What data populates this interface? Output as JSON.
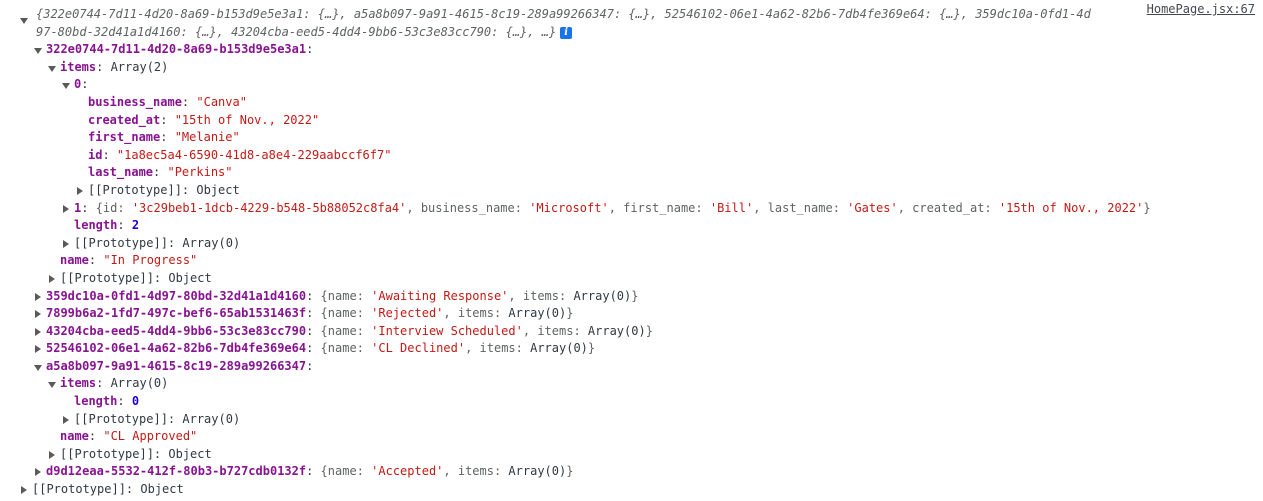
{
  "console": {
    "source_link": "HomePage.jsx:67",
    "info_badge": "i",
    "preview_line": "{322e0744-7d11-4d20-8a69-b153d9e5e3a1: {…}, a5a8b097-9a91-4615-8c19-289a99266347: {…}, 52546102-06e1-4a62-82b6-7db4fe369e64: {…}, 359dc10a-0fd1-4d97-80bd-32d41a1d4160: {…}, 43204cba-eed5-4dd4-9bb6-53c3e83cc790: {…}, …}"
  },
  "rows": [
    {
      "indent": 1,
      "arrow": "open",
      "parts": [
        {
          "t": "322e0744-7d11-4d20-8a69-b153d9e5e3a1",
          "c": "k-obj"
        },
        {
          "t": ":",
          "c": "punc"
        }
      ]
    },
    {
      "indent": 2,
      "arrow": "open",
      "parts": [
        {
          "t": "items",
          "c": "k-obj"
        },
        {
          "t": ": ",
          "c": "punc"
        },
        {
          "t": "Array(2)",
          "c": "v-obj"
        }
      ]
    },
    {
      "indent": 3,
      "arrow": "open",
      "parts": [
        {
          "t": "0",
          "c": "k-obj"
        },
        {
          "t": ":",
          "c": "punc"
        }
      ]
    },
    {
      "indent": 4,
      "arrow": "none",
      "parts": [
        {
          "t": "business_name",
          "c": "k-obj"
        },
        {
          "t": ": ",
          "c": "punc"
        },
        {
          "t": "\"Canva\"",
          "c": "v-str"
        }
      ]
    },
    {
      "indent": 4,
      "arrow": "none",
      "parts": [
        {
          "t": "created_at",
          "c": "k-obj"
        },
        {
          "t": ": ",
          "c": "punc"
        },
        {
          "t": "\"15th of Nov., 2022\"",
          "c": "v-str"
        }
      ]
    },
    {
      "indent": 4,
      "arrow": "none",
      "parts": [
        {
          "t": "first_name",
          "c": "k-obj"
        },
        {
          "t": ": ",
          "c": "punc"
        },
        {
          "t": "\"Melanie\"",
          "c": "v-str"
        }
      ]
    },
    {
      "indent": 4,
      "arrow": "none",
      "parts": [
        {
          "t": "id",
          "c": "k-obj"
        },
        {
          "t": ": ",
          "c": "punc"
        },
        {
          "t": "\"1a8ec5a4-6590-41d8-a8e4-229aabccf6f7\"",
          "c": "v-str"
        }
      ]
    },
    {
      "indent": 4,
      "arrow": "none",
      "parts": [
        {
          "t": "last_name",
          "c": "k-obj"
        },
        {
          "t": ": ",
          "c": "punc"
        },
        {
          "t": "\"Perkins\"",
          "c": "v-str"
        }
      ]
    },
    {
      "indent": 4,
      "arrow": "closed",
      "parts": [
        {
          "t": "[[Prototype]]",
          "c": "proto"
        },
        {
          "t": ": ",
          "c": "punc"
        },
        {
          "t": "Object",
          "c": "v-obj"
        }
      ]
    },
    {
      "indent": 3,
      "arrow": "closed",
      "parts": [
        {
          "t": "1",
          "c": "k-obj"
        },
        {
          "t": ": ",
          "c": "punc"
        },
        {
          "t": "{",
          "c": "k-gray"
        },
        {
          "t": "id",
          "c": "k-gray"
        },
        {
          "t": ": ",
          "c": "k-gray"
        },
        {
          "t": "'3c29beb1-1dcb-4229-b548-5b88052c8fa4'",
          "c": "v-str"
        },
        {
          "t": ", ",
          "c": "k-gray"
        },
        {
          "t": "business_name",
          "c": "k-gray"
        },
        {
          "t": ": ",
          "c": "k-gray"
        },
        {
          "t": "'Microsoft'",
          "c": "v-str"
        },
        {
          "t": ", ",
          "c": "k-gray"
        },
        {
          "t": "first_name",
          "c": "k-gray"
        },
        {
          "t": ": ",
          "c": "k-gray"
        },
        {
          "t": "'Bill'",
          "c": "v-str"
        },
        {
          "t": ", ",
          "c": "k-gray"
        },
        {
          "t": "last_name",
          "c": "k-gray"
        },
        {
          "t": ": ",
          "c": "k-gray"
        },
        {
          "t": "'Gates'",
          "c": "v-str"
        },
        {
          "t": ", ",
          "c": "k-gray"
        },
        {
          "t": "created_at",
          "c": "k-gray"
        },
        {
          "t": ": ",
          "c": "k-gray"
        },
        {
          "t": "'15th of Nov., 2022'",
          "c": "v-str"
        },
        {
          "t": "}",
          "c": "k-gray"
        }
      ]
    },
    {
      "indent": 3,
      "arrow": "none",
      "parts": [
        {
          "t": "length",
          "c": "k-obj"
        },
        {
          "t": ": ",
          "c": "punc"
        },
        {
          "t": "2",
          "c": "v-num"
        }
      ]
    },
    {
      "indent": 3,
      "arrow": "closed",
      "parts": [
        {
          "t": "[[Prototype]]",
          "c": "proto"
        },
        {
          "t": ": ",
          "c": "punc"
        },
        {
          "t": "Array(0)",
          "c": "v-obj"
        }
      ]
    },
    {
      "indent": 2,
      "arrow": "none",
      "parts": [
        {
          "t": "name",
          "c": "k-obj"
        },
        {
          "t": ": ",
          "c": "punc"
        },
        {
          "t": "\"In Progress\"",
          "c": "v-str"
        }
      ]
    },
    {
      "indent": 2,
      "arrow": "closed",
      "parts": [
        {
          "t": "[[Prototype]]",
          "c": "proto"
        },
        {
          "t": ": ",
          "c": "punc"
        },
        {
          "t": "Object",
          "c": "v-obj"
        }
      ]
    },
    {
      "indent": 1,
      "arrow": "closed",
      "parts": [
        {
          "t": "359dc10a-0fd1-4d97-80bd-32d41a1d4160",
          "c": "k-obj"
        },
        {
          "t": ": ",
          "c": "punc"
        },
        {
          "t": "{",
          "c": "k-gray"
        },
        {
          "t": "name",
          "c": "k-gray"
        },
        {
          "t": ": ",
          "c": "k-gray"
        },
        {
          "t": "'Awaiting Response'",
          "c": "v-str"
        },
        {
          "t": ", ",
          "c": "k-gray"
        },
        {
          "t": "items",
          "c": "k-gray"
        },
        {
          "t": ": ",
          "c": "k-gray"
        },
        {
          "t": "Array(0)",
          "c": "v-obj"
        },
        {
          "t": "}",
          "c": "k-gray"
        }
      ]
    },
    {
      "indent": 1,
      "arrow": "closed",
      "parts": [
        {
          "t": "7899b6a2-1fd7-497c-bef6-65ab1531463f",
          "c": "k-obj"
        },
        {
          "t": ": ",
          "c": "punc"
        },
        {
          "t": "{",
          "c": "k-gray"
        },
        {
          "t": "name",
          "c": "k-gray"
        },
        {
          "t": ": ",
          "c": "k-gray"
        },
        {
          "t": "'Rejected'",
          "c": "v-str"
        },
        {
          "t": ", ",
          "c": "k-gray"
        },
        {
          "t": "items",
          "c": "k-gray"
        },
        {
          "t": ": ",
          "c": "k-gray"
        },
        {
          "t": "Array(0)",
          "c": "v-obj"
        },
        {
          "t": "}",
          "c": "k-gray"
        }
      ]
    },
    {
      "indent": 1,
      "arrow": "closed",
      "parts": [
        {
          "t": "43204cba-eed5-4dd4-9bb6-53c3e83cc790",
          "c": "k-obj"
        },
        {
          "t": ": ",
          "c": "punc"
        },
        {
          "t": "{",
          "c": "k-gray"
        },
        {
          "t": "name",
          "c": "k-gray"
        },
        {
          "t": ": ",
          "c": "k-gray"
        },
        {
          "t": "'Interview Scheduled'",
          "c": "v-str"
        },
        {
          "t": ", ",
          "c": "k-gray"
        },
        {
          "t": "items",
          "c": "k-gray"
        },
        {
          "t": ": ",
          "c": "k-gray"
        },
        {
          "t": "Array(0)",
          "c": "v-obj"
        },
        {
          "t": "}",
          "c": "k-gray"
        }
      ]
    },
    {
      "indent": 1,
      "arrow": "closed",
      "parts": [
        {
          "t": "52546102-06e1-4a62-82b6-7db4fe369e64",
          "c": "k-obj"
        },
        {
          "t": ": ",
          "c": "punc"
        },
        {
          "t": "{",
          "c": "k-gray"
        },
        {
          "t": "name",
          "c": "k-gray"
        },
        {
          "t": ": ",
          "c": "k-gray"
        },
        {
          "t": "'CL Declined'",
          "c": "v-str"
        },
        {
          "t": ", ",
          "c": "k-gray"
        },
        {
          "t": "items",
          "c": "k-gray"
        },
        {
          "t": ": ",
          "c": "k-gray"
        },
        {
          "t": "Array(0)",
          "c": "v-obj"
        },
        {
          "t": "}",
          "c": "k-gray"
        }
      ]
    },
    {
      "indent": 1,
      "arrow": "open",
      "parts": [
        {
          "t": "a5a8b097-9a91-4615-8c19-289a99266347",
          "c": "k-obj"
        },
        {
          "t": ":",
          "c": "punc"
        }
      ]
    },
    {
      "indent": 2,
      "arrow": "open",
      "parts": [
        {
          "t": "items",
          "c": "k-obj"
        },
        {
          "t": ": ",
          "c": "punc"
        },
        {
          "t": "Array(0)",
          "c": "v-obj"
        }
      ]
    },
    {
      "indent": 3,
      "arrow": "none",
      "parts": [
        {
          "t": "length",
          "c": "k-obj"
        },
        {
          "t": ": ",
          "c": "punc"
        },
        {
          "t": "0",
          "c": "v-num"
        }
      ]
    },
    {
      "indent": 3,
      "arrow": "closed",
      "parts": [
        {
          "t": "[[Prototype]]",
          "c": "proto"
        },
        {
          "t": ": ",
          "c": "punc"
        },
        {
          "t": "Array(0)",
          "c": "v-obj"
        }
      ]
    },
    {
      "indent": 2,
      "arrow": "none",
      "parts": [
        {
          "t": "name",
          "c": "k-obj"
        },
        {
          "t": ": ",
          "c": "punc"
        },
        {
          "t": "\"CL Approved\"",
          "c": "v-str"
        }
      ]
    },
    {
      "indent": 2,
      "arrow": "closed",
      "parts": [
        {
          "t": "[[Prototype]]",
          "c": "proto"
        },
        {
          "t": ": ",
          "c": "punc"
        },
        {
          "t": "Object",
          "c": "v-obj"
        }
      ]
    },
    {
      "indent": 1,
      "arrow": "closed",
      "parts": [
        {
          "t": "d9d12eaa-5532-412f-80b3-b727cdb0132f",
          "c": "k-obj"
        },
        {
          "t": ": ",
          "c": "punc"
        },
        {
          "t": "{",
          "c": "k-gray"
        },
        {
          "t": "name",
          "c": "k-gray"
        },
        {
          "t": ": ",
          "c": "k-gray"
        },
        {
          "t": "'Accepted'",
          "c": "v-str"
        },
        {
          "t": ", ",
          "c": "k-gray"
        },
        {
          "t": "items",
          "c": "k-gray"
        },
        {
          "t": ": ",
          "c": "k-gray"
        },
        {
          "t": "Array(0)",
          "c": "v-obj"
        },
        {
          "t": "}",
          "c": "k-gray"
        }
      ]
    },
    {
      "indent": 0,
      "arrow": "closed",
      "parts": [
        {
          "t": "[[Prototype]]",
          "c": "proto"
        },
        {
          "t": ": ",
          "c": "punc"
        },
        {
          "t": "Object",
          "c": "v-obj"
        }
      ]
    }
  ]
}
